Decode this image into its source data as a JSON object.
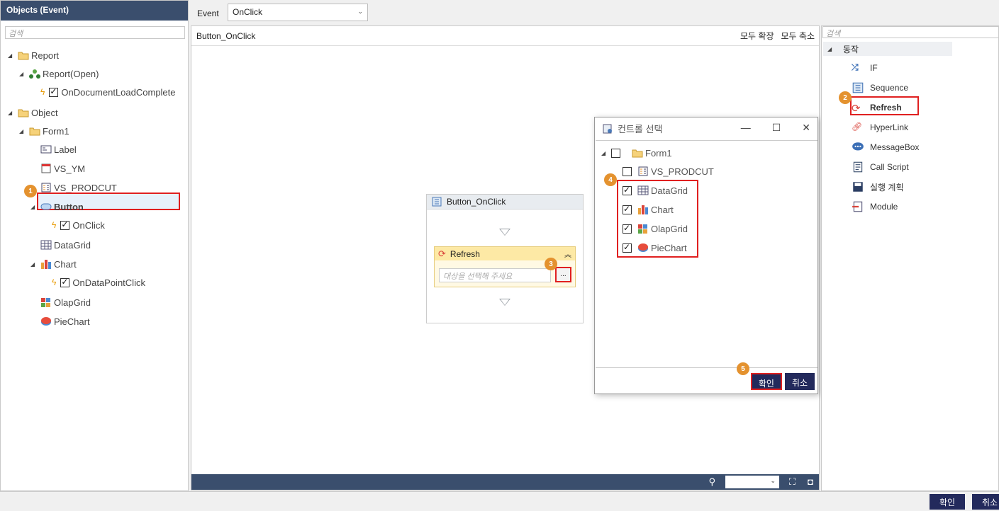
{
  "left_panel": {
    "title": "Objects (Event)",
    "search_placeholder": "검색",
    "tree": {
      "report": "Report",
      "report_open": "Report(Open)",
      "on_doc_load": "OnDocumentLoadComplete",
      "object": "Object",
      "form1": "Form1",
      "label": "Label",
      "vs_ym": "VS_YM",
      "vs_prodcut": "VS_PRODCUT",
      "button": "Button",
      "onclick": "OnClick",
      "datagrid": "DataGrid",
      "chart": "Chart",
      "on_data_point_click": "OnDataPointClick",
      "olapgrid": "OlapGrid",
      "piechart": "PieChart"
    }
  },
  "topbar": {
    "event_label": "Event",
    "event_value": "OnClick"
  },
  "canvas": {
    "title": "Button_OnClick",
    "expand_all": "모두 확장",
    "collapse_all": "모두 축소",
    "flow_title": "Button_OnClick",
    "refresh_label": "Refresh",
    "target_placeholder": "대상을 선택해 주세요",
    "dots": "..."
  },
  "dialog": {
    "title": "컨트롤 선택",
    "form1": "Form1",
    "items": [
      "VS_PRODCUT",
      "DataGrid",
      "Chart",
      "OlapGrid",
      "PieChart"
    ],
    "ok": "확인",
    "cancel": "취소"
  },
  "right_panel": {
    "search_placeholder": "검색",
    "group": "동작",
    "actions": [
      "IF",
      "Sequence",
      "Refresh",
      "HyperLink",
      "MessageBox",
      "Call Script",
      "실행 계획",
      "Module"
    ]
  },
  "bottom": {
    "ok": "확인",
    "cancel": "취소"
  },
  "badges": [
    "1",
    "2",
    "3",
    "4",
    "5"
  ],
  "colors": {
    "header_bg": "#3a4e6d",
    "highlight_red": "#e02020",
    "badge": "#e4922f",
    "button_dark": "#232a5c"
  }
}
